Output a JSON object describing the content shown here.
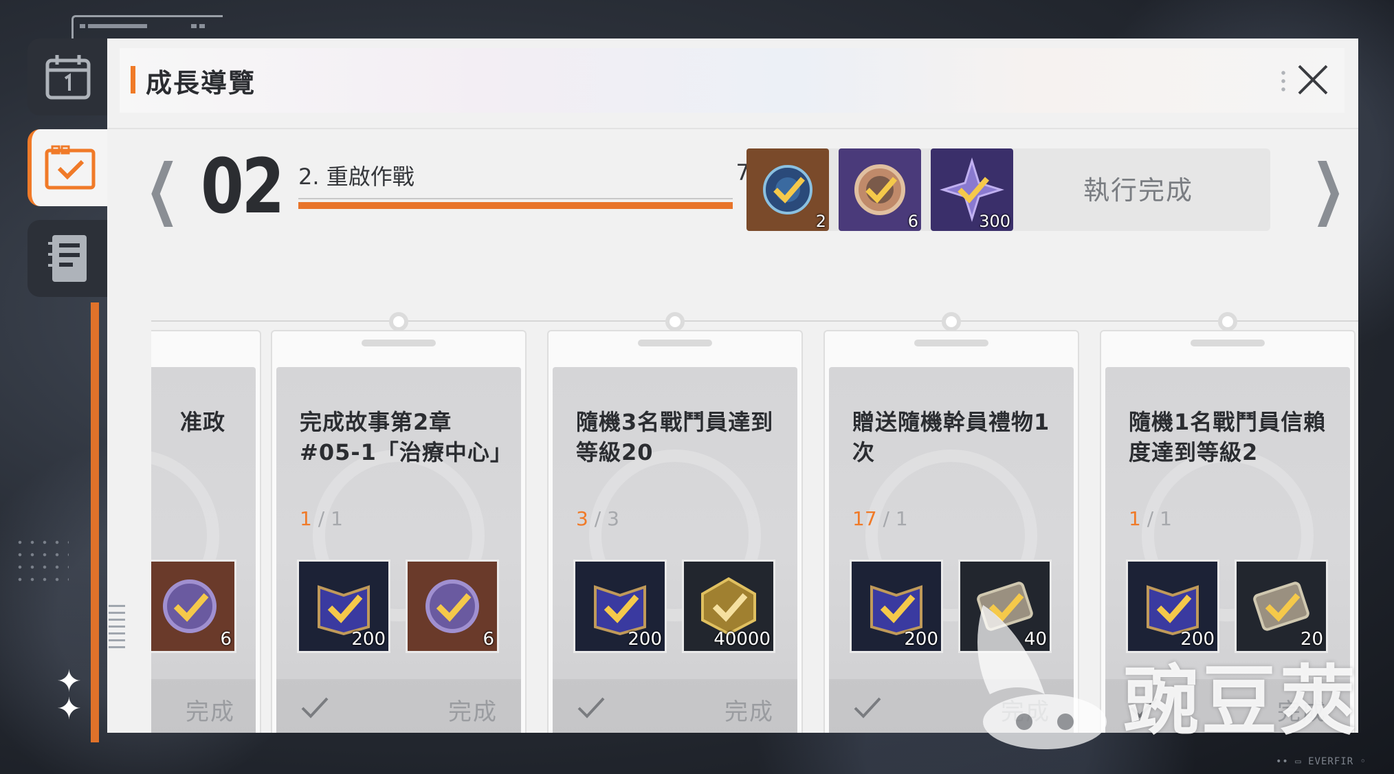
{
  "header": {
    "title": "成長導覽"
  },
  "stage": {
    "number": "02",
    "name": "2. 重啟作戰",
    "progress_text": "7/7",
    "progress_fraction": 1.0,
    "rewards": [
      {
        "icon": "core-orb-icon",
        "qty": "2",
        "bg": "#7a4a2a"
      },
      {
        "icon": "gear-capsule-icon",
        "qty": "6",
        "bg": "#4a3a7a"
      },
      {
        "icon": "star-crystal-icon",
        "qty": "300",
        "bg": "#3a2f6a"
      }
    ],
    "exec_label": "執行完成"
  },
  "cards": [
    {
      "title": "准政",
      "count_current": "",
      "count_total": "",
      "rewards": [
        {
          "icon": "gear-capsule-icon",
          "qty": "6"
        }
      ],
      "done_label": "完成"
    },
    {
      "title": "完成故事第2章 #05-1「治療中心」",
      "count_current": "1",
      "count_total": "/ 1",
      "rewards": [
        {
          "icon": "exp-book-icon",
          "qty": "200"
        },
        {
          "icon": "gear-capsule-icon",
          "qty": "6"
        }
      ],
      "done_label": "完成"
    },
    {
      "title": "隨機3名戰鬥員達到等級20",
      "count_current": "3",
      "count_total": "/ 3",
      "rewards": [
        {
          "icon": "exp-book-icon",
          "qty": "200"
        },
        {
          "icon": "gold-box-icon",
          "qty": "40000"
        }
      ],
      "done_label": "完成"
    },
    {
      "title": "贈送隨機幹員禮物1次",
      "count_current": "17",
      "count_total": "/ 1",
      "rewards": [
        {
          "icon": "exp-book-icon",
          "qty": "200"
        },
        {
          "icon": "ticket-icon",
          "qty": "40"
        }
      ],
      "done_label": "完成"
    },
    {
      "title": "隨機1名戰鬥員信賴度達到等級2",
      "count_current": "1",
      "count_total": "/ 1",
      "rewards": [
        {
          "icon": "exp-book-icon",
          "qty": "200"
        },
        {
          "icon": "ticket-icon",
          "qty": "20"
        }
      ],
      "done_label": "完成"
    }
  ],
  "watermark": {
    "text": "豌豆莢"
  },
  "footer_text": "•• ▭ EVERFIR ◦",
  "colors": {
    "accent": "#f07a28",
    "panel": "#f1f1f1"
  }
}
